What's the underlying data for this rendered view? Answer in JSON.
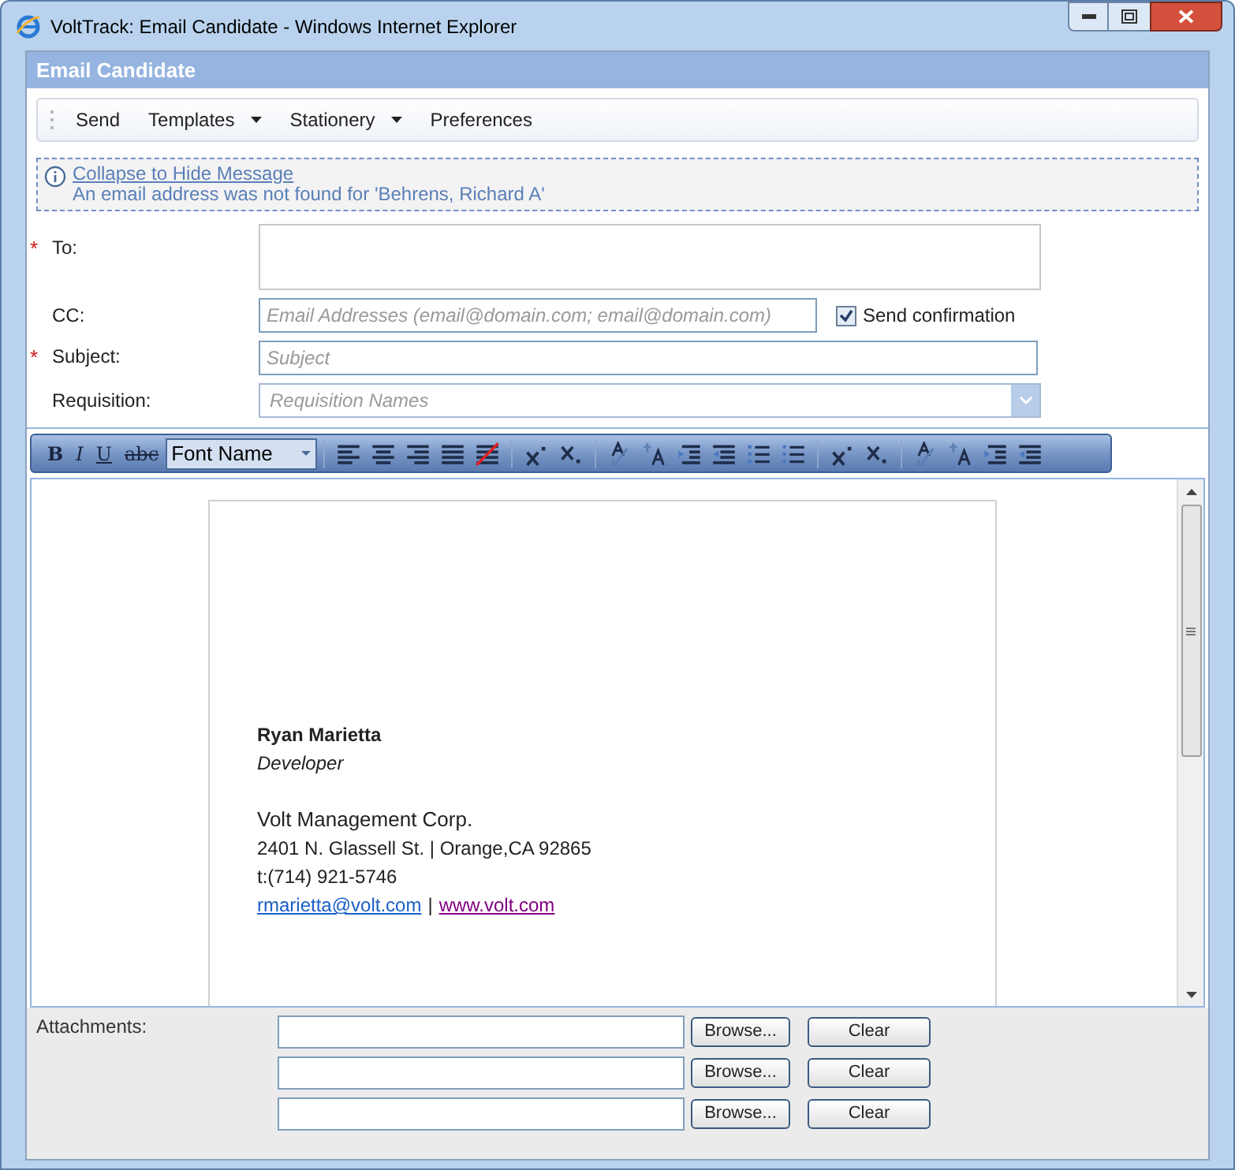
{
  "window": {
    "title": "VoltTrack: Email Candidate - Windows Internet Explorer"
  },
  "panel": {
    "title": "Email Candidate"
  },
  "toolbar": [
    {
      "label": "Send",
      "dropdown": false
    },
    {
      "label": "Templates",
      "dropdown": true
    },
    {
      "label": "Stationery",
      "dropdown": true
    },
    {
      "label": "Preferences",
      "dropdown": false
    }
  ],
  "message": {
    "link": "Collapse to Hide Message",
    "text": "An email address was not found for 'Behrens, Richard A'"
  },
  "form": {
    "to": {
      "label": "To:",
      "mark": "*"
    },
    "cc": {
      "label": "CC:",
      "placeholder": "Email Addresses (email@domain.com; email@domain.com)"
    },
    "confirmation": {
      "label": "Send confirmation",
      "checked": true
    },
    "subject": {
      "label": "Subject:",
      "mark": "*",
      "placeholder": "Subject"
    },
    "requisition": {
      "label": "Requisition:",
      "placeholder": "Requisition Names"
    }
  },
  "editor_toolbar": {
    "letters": [
      "B",
      "I",
      "U",
      "abc"
    ],
    "font": "Font Name"
  },
  "signature": {
    "name": "Ryan Marietta",
    "title": "Developer",
    "company": "Volt Management Corp.",
    "address": "2401 N. Glassell St. | Orange,CA 92865",
    "phone": "t:(714) 921-5746",
    "email": "rmarietta@volt.com",
    "separator": "|",
    "website": "www.volt.com"
  },
  "attachments": {
    "label": "Attachments:",
    "rows": [
      {
        "browse": "Browse...",
        "clear": "Clear"
      },
      {
        "browse": "Browse...",
        "clear": "Clear"
      },
      {
        "browse": "Browse...",
        "clear": "Clear"
      }
    ]
  }
}
